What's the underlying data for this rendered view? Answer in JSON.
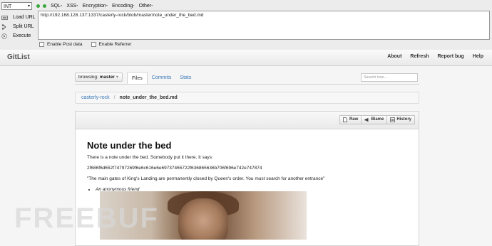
{
  "hackbar": {
    "select_value": "INT",
    "menus": [
      "SQL-",
      "XSS-",
      "Encryption-",
      "Encoding-",
      "Other-"
    ],
    "actions": [
      {
        "label": "Load URL",
        "icon": "load-url-icon"
      },
      {
        "label": "Split URL",
        "icon": "split-url-icon"
      },
      {
        "label": "Execute",
        "icon": "execute-icon"
      }
    ],
    "url": "http://192.168.128.137:1337/casterly-rock/blob/master/note_under_the_bed.md",
    "options": [
      "Enable Post data",
      "Enable Referrer"
    ]
  },
  "navbar": {
    "brand": "GitList",
    "links": [
      "About",
      "Refresh",
      "Report bug",
      "Help"
    ]
  },
  "repo": {
    "branch_label": "browsing:",
    "branch": "master",
    "tabs": [
      "Files",
      "Commits",
      "Stats"
    ],
    "search_placeholder": "Search tree...",
    "breadcrumb_repo": "casterly-rock",
    "breadcrumb_sep": "/",
    "breadcrumb_file": "note_under_the_bed.md",
    "file_buttons": [
      "Raw",
      "Blame",
      "History"
    ]
  },
  "doc": {
    "title": "Note under the bed",
    "p1": "There is a note under the bed. Somebody put it there. It says:",
    "hex": "2f686f6d652f74797269f6e6c616e6e69737465722f636865636b706f696e742e747874",
    "quote": "\"The main gates of King's Landing are permanently closed by Queen's order. You must search for another entrance\"",
    "author": "An anonymous friend"
  },
  "watermark": "FREEBUF"
}
